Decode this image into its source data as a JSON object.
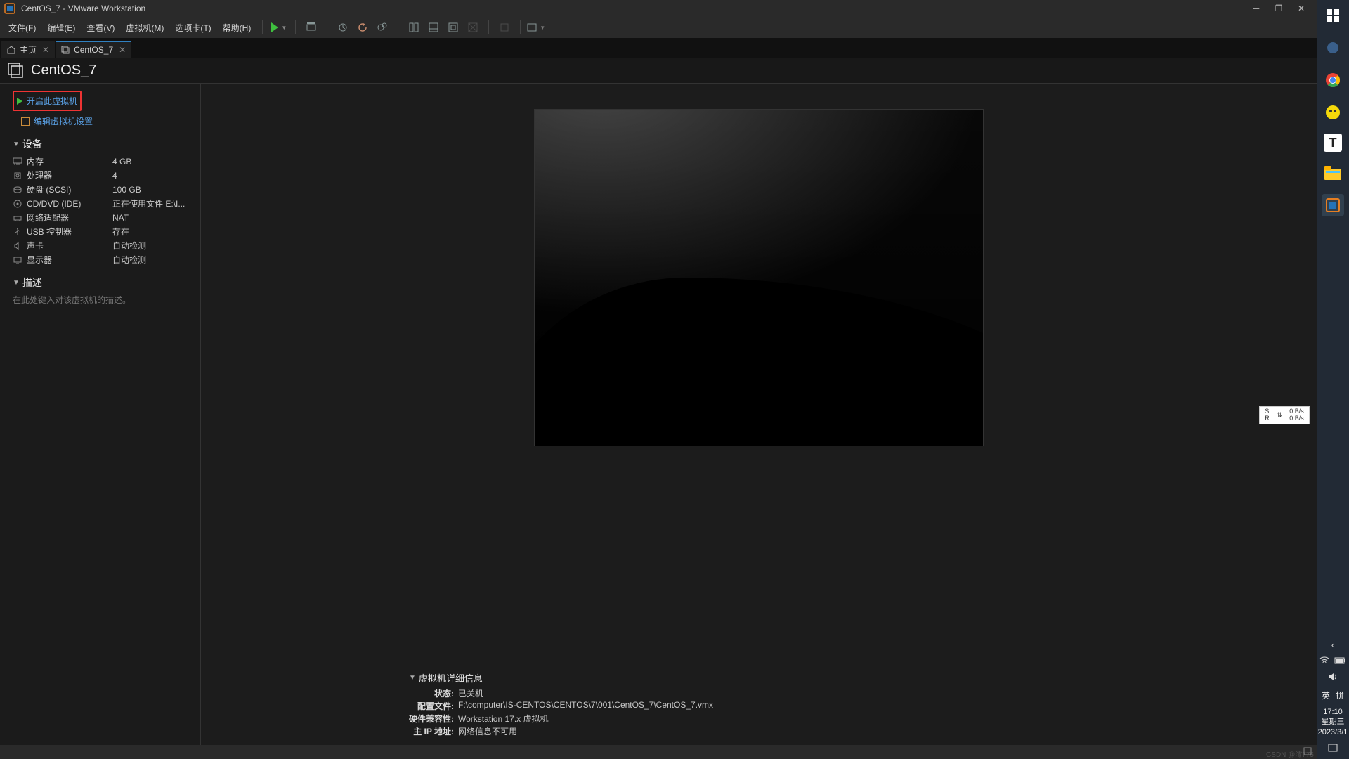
{
  "window": {
    "title": "CentOS_7 - VMware Workstation"
  },
  "menubar": [
    "文件(F)",
    "编辑(E)",
    "查看(V)",
    "虚拟机(M)",
    "选项卡(T)",
    "帮助(H)"
  ],
  "tabs": [
    {
      "label": "主页",
      "icon": "home"
    },
    {
      "label": "CentOS_7",
      "icon": "vm"
    }
  ],
  "vm_name": "CentOS_7",
  "actions": {
    "power_on": "开启此虚拟机",
    "edit": "编辑虚拟机设置"
  },
  "sections": {
    "devices": "设备",
    "description": "描述"
  },
  "devices": [
    {
      "icon": "memory",
      "label": "内存",
      "value": "4 GB"
    },
    {
      "icon": "cpu",
      "label": "处理器",
      "value": "4"
    },
    {
      "icon": "disk",
      "label": "硬盘 (SCSI)",
      "value": "100 GB"
    },
    {
      "icon": "cd",
      "label": "CD/DVD (IDE)",
      "value": "正在使用文件 E:\\I..."
    },
    {
      "icon": "net",
      "label": "网络适配器",
      "value": "NAT"
    },
    {
      "icon": "usb",
      "label": "USB 控制器",
      "value": "存在"
    },
    {
      "icon": "sound",
      "label": "声卡",
      "value": "自动检测"
    },
    {
      "icon": "display",
      "label": "显示器",
      "value": "自动检测"
    }
  ],
  "description_placeholder": "在此处键入对该虚拟机的描述。",
  "details": {
    "header": "虚拟机详细信息",
    "rows": [
      {
        "label": "状态:",
        "value": "已关机"
      },
      {
        "label": "配置文件:",
        "value": "F:\\computer\\IS-CENTOS\\CENTOS\\7\\001\\CentOS_7\\CentOS_7.vmx"
      },
      {
        "label": "硬件兼容性:",
        "value": "Workstation 17.x 虚拟机"
      },
      {
        "label": "主 IP 地址:",
        "value": "网络信息不可用"
      }
    ]
  },
  "network_widget": {
    "s": "S",
    "r": "R",
    "up": "0 B/s",
    "down": "0 B/s"
  },
  "systray": {
    "ime1": "英",
    "ime2": "拼",
    "time": "17:10",
    "day": "星期三",
    "date": "2023/3/1"
  },
  "watermark": "CSDN @澪775"
}
